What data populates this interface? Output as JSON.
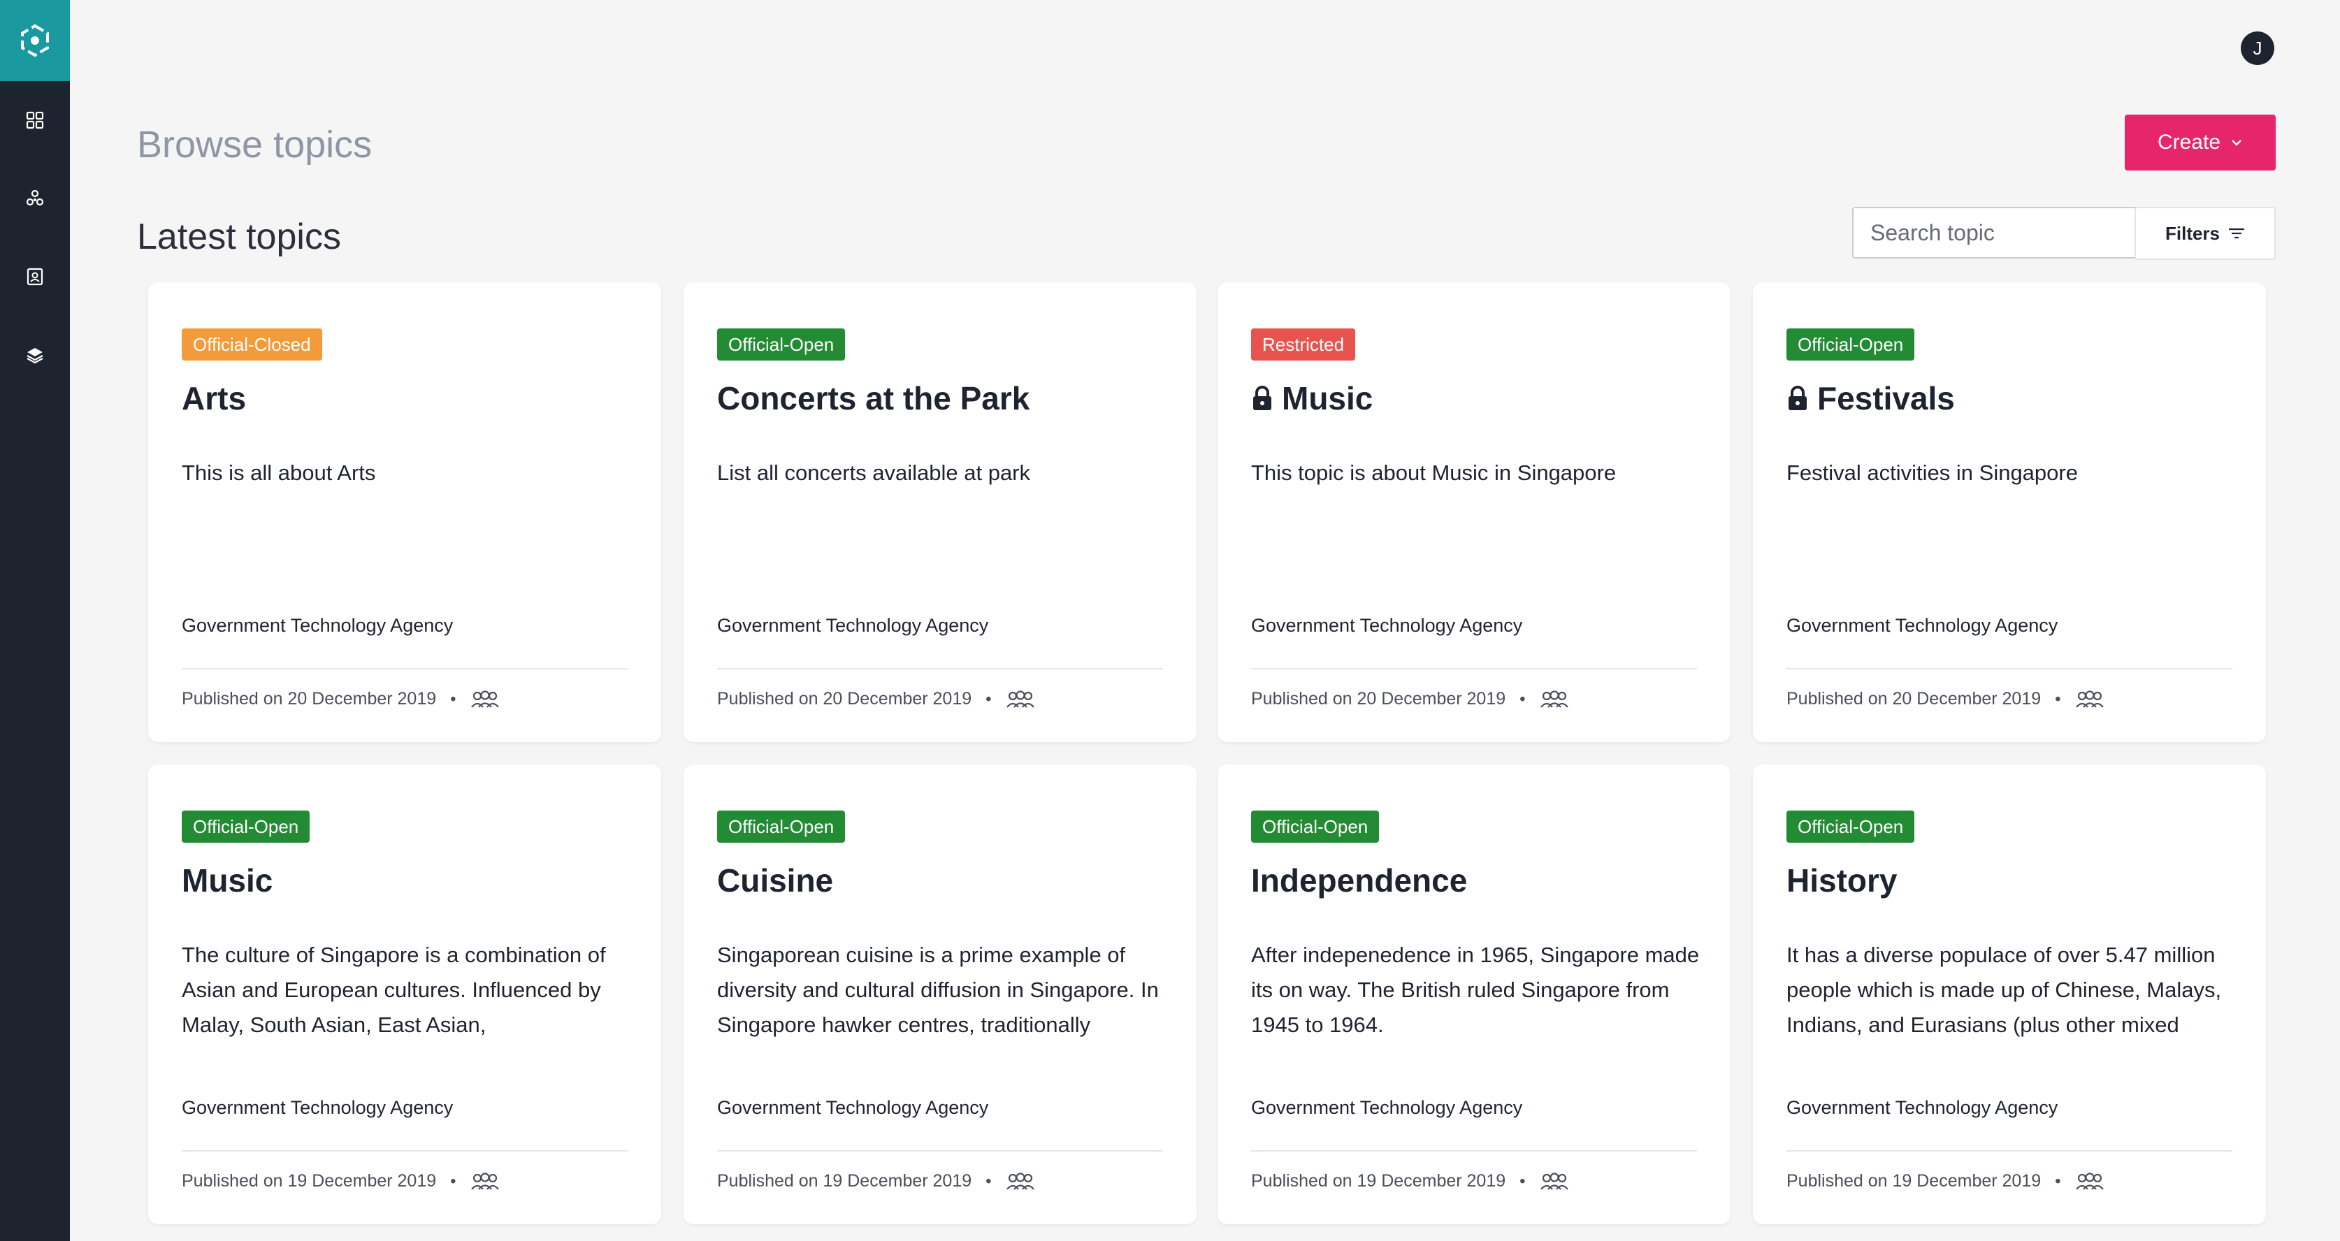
{
  "header": {
    "page_title": "Browse topics",
    "avatar_initial": "J",
    "create_label": "Create"
  },
  "section": {
    "title": "Latest topics",
    "search_placeholder": "Search topic",
    "filters_label": "Filters"
  },
  "sidebar": {
    "items": [
      {
        "icon": "dashboard-grid-icon"
      },
      {
        "icon": "network-icon"
      },
      {
        "icon": "contact-card-icon"
      },
      {
        "icon": "layers-icon"
      }
    ]
  },
  "badge_colors": {
    "Official-Closed": "#f39a3a",
    "Official-Open": "#228b34",
    "Restricted": "#e8534f"
  },
  "cards": [
    {
      "badge": "Official-Closed",
      "title": "Arts",
      "locked": false,
      "description": "This is all about Arts",
      "agency": "Government Technology Agency",
      "published": "Published on 20 December 2019",
      "bullet": "•"
    },
    {
      "badge": "Official-Open",
      "title": "Concerts at the Park",
      "locked": false,
      "description": "List all concerts available at park",
      "agency": "Government Technology Agency",
      "published": "Published on 20 December 2019",
      "bullet": "•"
    },
    {
      "badge": "Restricted",
      "title": "Music",
      "locked": true,
      "description": "This topic is about Music in Singapore",
      "agency": "Government Technology Agency",
      "published": "Published on 20 December 2019",
      "bullet": "•"
    },
    {
      "badge": "Official-Open",
      "title": "Festivals",
      "locked": true,
      "description": "Festival activities in Singapore",
      "agency": "Government Technology Agency",
      "published": "Published on 20 December 2019",
      "bullet": "•"
    },
    {
      "badge": "Official-Open",
      "title": "Music",
      "locked": false,
      "description": "The culture of Singapore is a combination of Asian and European cultures. Influenced by Malay, South Asian, East Asian,",
      "agency": "Government Technology Agency",
      "published": "Published on 19 December 2019",
      "bullet": "•"
    },
    {
      "badge": "Official-Open",
      "title": "Cuisine",
      "locked": false,
      "description": "Singaporean cuisine is a prime example of diversity and cultural diffusion in Singapore. In Singapore hawker centres, traditionally",
      "agency": "Government Technology Agency",
      "published": "Published on 19 December 2019",
      "bullet": "•"
    },
    {
      "badge": "Official-Open",
      "title": "Independence",
      "locked": false,
      "description": "After indepenedence in 1965, Singapore made its on way. The British ruled Singapore from 1945 to 1964.",
      "agency": "Government Technology Agency",
      "published": "Published on 19 December 2019",
      "bullet": "•"
    },
    {
      "badge": "Official-Open",
      "title": "History",
      "locked": false,
      "description": "It has a diverse populace of over 5.47 million people which is made up of Chinese, Malays, Indians, and Eurasians (plus other mixed",
      "agency": "Government Technology Agency",
      "published": "Published on 19 December 2019",
      "bullet": "•"
    }
  ]
}
